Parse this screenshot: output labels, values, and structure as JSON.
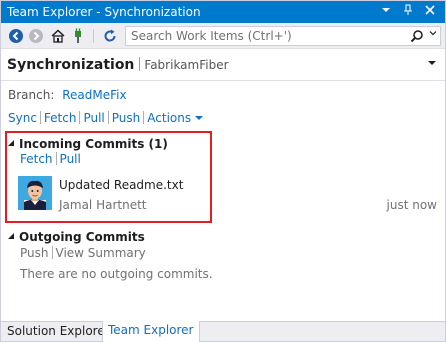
{
  "window": {
    "title": "Team Explorer - Synchronization",
    "controls": [
      "dropdown-icon",
      "pin-icon",
      "close-icon"
    ]
  },
  "toolbar": {
    "buttons": [
      "back-icon",
      "forward-icon",
      "home-icon",
      "connect-icon",
      "refresh-icon"
    ],
    "search_placeholder": "Search Work Items (Ctrl+')"
  },
  "header": {
    "title": "Synchronization",
    "repo": "FabrikamFiber"
  },
  "branch": {
    "label": "Branch:",
    "name": "ReadMeFix"
  },
  "actions": {
    "sync": "Sync",
    "fetch": "Fetch",
    "pull": "Pull",
    "push": "Push",
    "actions": "Actions"
  },
  "incoming": {
    "heading": "Incoming Commits (1)",
    "fetch": "Fetch",
    "pull": "Pull",
    "commits": [
      {
        "message": "Updated Readme.txt",
        "author": "Jamal Hartnett",
        "time": "just now"
      }
    ]
  },
  "outgoing": {
    "heading": "Outgoing Commits",
    "push": "Push",
    "view_summary": "View Summary",
    "empty": "There are no outgoing commits."
  },
  "tabs": {
    "solution_explorer": "Solution Explorer",
    "team_explorer": "Team Explorer",
    "active": "Team Explorer"
  },
  "colors": {
    "accent": "#007acc",
    "link": "#0e70c0",
    "highlight_border": "#e01e24"
  }
}
